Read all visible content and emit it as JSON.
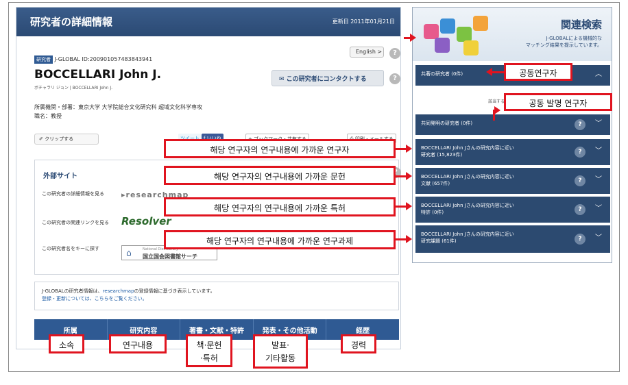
{
  "left_panel": {
    "title": "研究者の詳細情報",
    "updated": "更新日 2011年01月21日",
    "researcher_tag": "研究者",
    "id_text": "J-GLOBAL ID:200901057483843941",
    "english_label": "English  >",
    "help_glyph": "?",
    "name": "BOCCELLARI John J.",
    "kana": "ボチャラリ ジョン | BOCCELLARI John J.",
    "contact_label": "✉  この研究者にコンタクトする",
    "affiliation": "所属機関・部署：東京大学 大学院総合文化研究科 超域文化科学専攻",
    "position": "職名：教授",
    "clip_label": "✐ クリップする",
    "tweet_label": "ツイート",
    "like_label": "f いいね",
    "bookmark_label": "+ ブックマーク・共有する",
    "print_label": "⎙ 印刷・メールする",
    "external": {
      "title": "外部サイト",
      "rows": [
        {
          "label": "この研究者の詳細情報を見る",
          "logo": "▸researchmap"
        },
        {
          "label": "この研究者の関連リンクを見る",
          "logo": "Resolver"
        },
        {
          "label": "この研究者名をキーに探す",
          "logo_sub": "National Diet Library",
          "logo_main": "国立国会図書館サーチ"
        }
      ]
    },
    "info_line1": "J-GLOBALの研究者情報は、",
    "info_link": "researchmap",
    "info_line1b": "の登録情報に基づき表示しています。",
    "info_line2": "登録・更新については、こちらをご覧ください。",
    "nav": [
      "所属",
      "研究内容",
      "著書・文献・特許",
      "発表・その他活動",
      "経歴"
    ]
  },
  "right_panel": {
    "title": "関連検索",
    "sub1": "J-GLOBALによる機械的な",
    "sub2": "マッチング結果を提示しています。",
    "coauthors": "共著の研究者 (0件)",
    "coauthors_empty": "該当する研究者はいません",
    "coinventors": "共同発明の研究者 (0件)",
    "researchers_1": "BOCCELLARI John Jさんの研究内容に近い",
    "researchers_2": "研究者 (15,823件)",
    "literature_1": "BOCCELLARI John Jさんの研究内容に近い",
    "literature_2": "文献 (657件)",
    "patents_1": "BOCCELLARI John Jさんの研究内容に近い",
    "patents_2": "特許 (0件)",
    "projects_1": "BOCCELLARI John Jさんの研究内容に近い",
    "projects_2": "研究課題 (61件)",
    "chevron_up": "︿",
    "chevron_down": "﹀"
  },
  "annotations": {
    "coauthor": "공동연구자",
    "coinventor": "공동 발명 연구자",
    "near_researchers": "해당 연구자의 연구내용에 가까운 연구자",
    "near_literature": "해당 연구자의 연구내용에 가까운 문헌",
    "near_patents": "해당 연구자의 연구내용에 가까운 특허",
    "near_projects": "해당 연구자의 연구내용에 가까운 연구과제",
    "affiliation": "소속",
    "research": "연구내용",
    "books_1": "책·문헌",
    "books_2": "·특허",
    "talks_1": "발표·",
    "talks_2": "기타활동",
    "career": "경력"
  },
  "colors": {
    "header_blue": "#2b4a74",
    "annotation_red": "#e0141f",
    "nav_blue": "#2f5a93"
  }
}
